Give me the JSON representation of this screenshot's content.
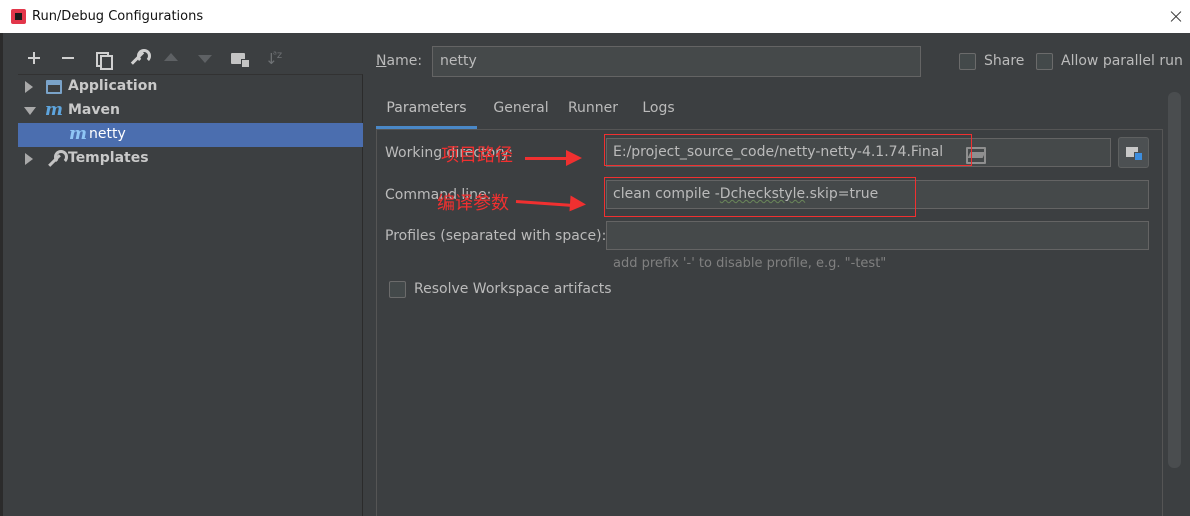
{
  "window": {
    "title": "Run/Debug Configurations"
  },
  "tree": {
    "items": [
      {
        "label": "Application",
        "expanded": false,
        "icon": "application-icon"
      },
      {
        "label": "Maven",
        "expanded": true,
        "icon": "maven-icon"
      },
      {
        "label": "netty",
        "selected": true,
        "icon": "maven-icon"
      },
      {
        "label": "Templates",
        "expanded": false,
        "icon": "wrench-icon"
      }
    ]
  },
  "header": {
    "name_label": "Name:",
    "name_value": "netty",
    "share_label": "Share",
    "share_checked": false,
    "parallel_label": "Allow parallel run",
    "parallel_checked": false
  },
  "tabs": [
    {
      "label": "Parameters",
      "active": true
    },
    {
      "label": "General"
    },
    {
      "label": "Runner"
    },
    {
      "label": "Logs"
    }
  ],
  "parameters": {
    "working_dir_label": "Working directory:",
    "working_dir_value": "E:/project_source_code/netty-netty-4.1.74.Final",
    "command_line_label": "Command line:",
    "command_prefix": "clean compile -",
    "command_squiggle": "Dcheckstyle",
    "command_suffix": ".skip=true",
    "profiles_label": "Profiles (separated with space):",
    "profiles_value": "",
    "profiles_hint": "add prefix '-' to disable profile, e.g. \"-test\"",
    "resolve_label": "Resolve Workspace artifacts",
    "resolve_checked": false
  },
  "annotations": {
    "project_path": "项目路径",
    "compile_params": "编译参数"
  },
  "colors": {
    "background": "#3c3f41",
    "selection": "#4b6eaf",
    "tab_underline": "#4a88c7",
    "annotation_red": "#f03030"
  }
}
